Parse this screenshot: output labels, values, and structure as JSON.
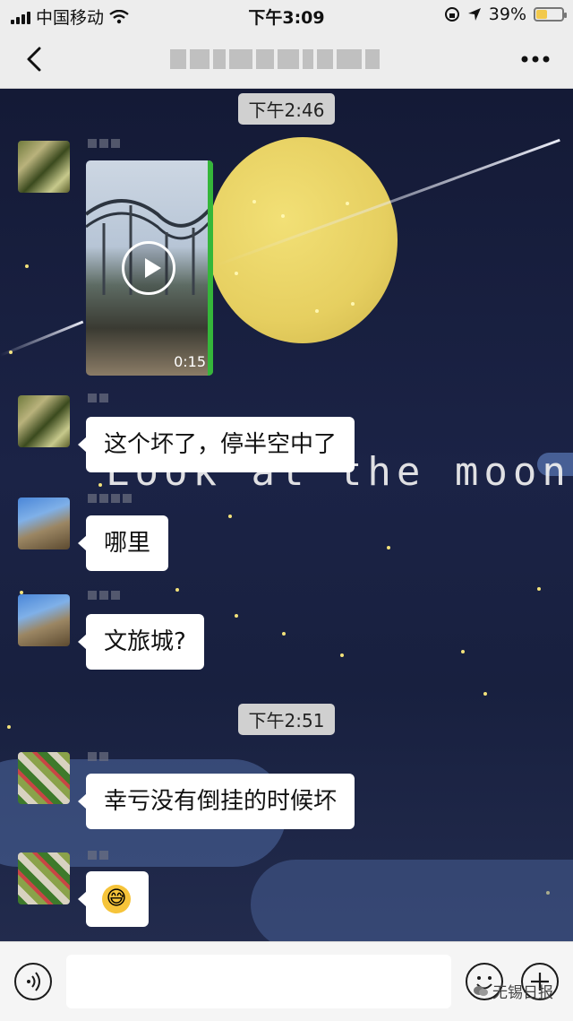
{
  "status_bar": {
    "carrier": "中国移动",
    "time": "下午3:09",
    "battery": "39%"
  },
  "chat": {
    "background_text": "Look at the moon",
    "items": [
      {
        "type": "timestamp",
        "text": "下午2:46"
      },
      {
        "type": "video",
        "duration": "0:15"
      },
      {
        "type": "text",
        "text": "这个坏了，停半空中了"
      },
      {
        "type": "text",
        "text": "哪里"
      },
      {
        "type": "text",
        "text": "文旅城?"
      },
      {
        "type": "timestamp",
        "text": "下午2:51"
      },
      {
        "type": "text",
        "text": "幸亏没有倒挂的时候坏"
      },
      {
        "type": "emoji",
        "icon": "grinning-sweat-emoji"
      }
    ]
  },
  "input_bar": {
    "watermark": "无锡日报"
  },
  "colors": {
    "chat_bg": "#151c3a",
    "moon": "#e6cf60",
    "video_accent": "#35b63a"
  }
}
